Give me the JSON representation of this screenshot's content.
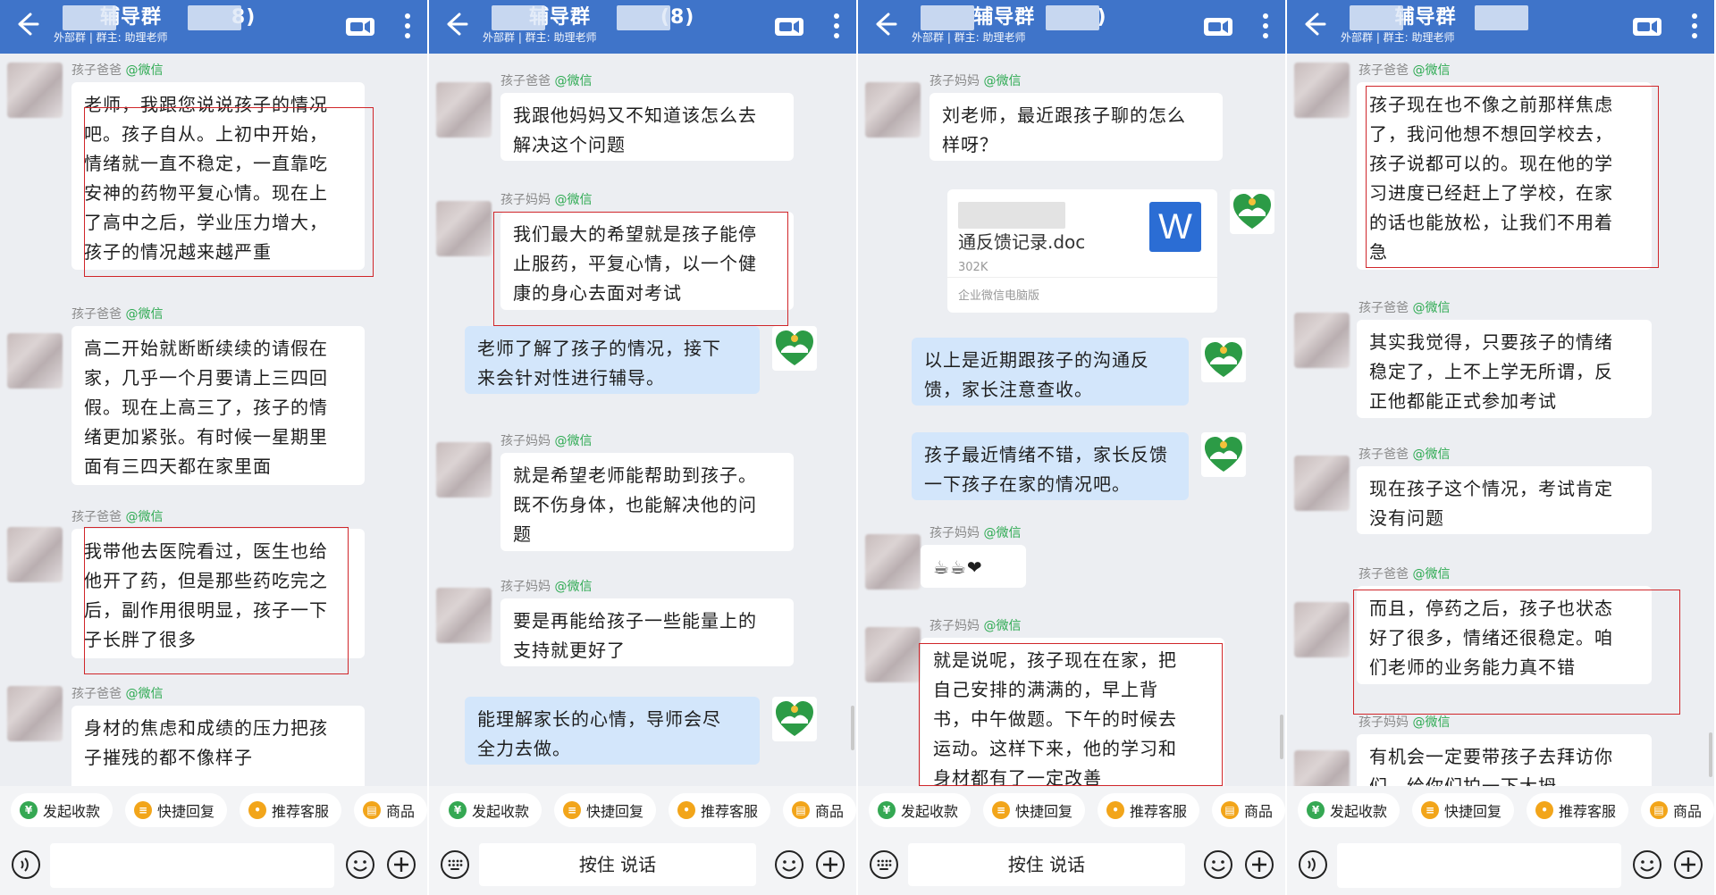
{
  "common": {
    "subtitle": "外部群 | 群主: 助理老师",
    "toolbar": [
      "发起收款",
      "快捷回复",
      "推荐客服",
      "商品"
    ],
    "hold_to_talk": "按住 说话"
  },
  "screens": [
    {
      "title": "      辅导群         8)",
      "messages": [
        {
          "sender": "孩子爸爸",
          "text": "老师，我跟您说说孩子的情况\n吧。孩子自从。上初中开始，\n情绪就一直不稳定，一直靠吃\n安神的药物平复心情。现在上\n了高中之后，学业压力增大，\n孩子的情况越来越严重"
        },
        {
          "sender": "孩子爸爸",
          "text": "高二开始就断断续续的请假在\n家，几乎一个月要请上三四回\n假。现在上高三了，孩子的情\n绪更加紧张。有时候一星期里\n面有三四天都在家里面"
        },
        {
          "sender": "孩子爸爸",
          "text": "我带他去医院看过，医生也给\n他开了药，但是那些药吃完之\n后，副作用很明显，孩子一下\n子长胖了很多"
        },
        {
          "sender": "孩子爸爸",
          "text": "身材的焦虑和成绩的压力把孩\n子摧残的都不像样子"
        }
      ]
    },
    {
      "title": "      辅导群         (8)",
      "messages": [
        {
          "sender": "孩子爸爸",
          "text": "我跟他妈妈又不知道该怎么去\n解决这个问题"
        },
        {
          "sender": "孩子妈妈",
          "text": "我们最大的希望就是孩子能停\n止服药，平复心情，以一个健\n康的身心去面对考试"
        },
        {
          "sender": "",
          "text": "老师了解了孩子的情况，接下\n来会针对性进行辅导。"
        },
        {
          "sender": "孩子妈妈",
          "text": "就是希望老师能帮助到孩子。\n既不伤身体，也能解决他的问\n题"
        },
        {
          "sender": "孩子妈妈",
          "text": "要是再能给孩子一些能量上的\n支持就更好了"
        },
        {
          "sender": "",
          "text": "能理解家长的心情，导师会尽\n全力去做。"
        }
      ]
    },
    {
      "title": "        辅导群        )",
      "messages": [
        {
          "sender": "孩子妈妈",
          "text": "刘老师，最近跟孩子聊的怎么\n样呀？"
        },
        {
          "sender": "",
          "text": "以上是近期跟孩子的沟通反\n馈，家长注意查收。"
        },
        {
          "sender": "",
          "text": "孩子最近情绪不错，家长反馈\n一下孩子在家的情况吧。"
        },
        {
          "sender": "孩子妈妈",
          "text": "☕☕❤"
        },
        {
          "sender": "孩子妈妈",
          "text": "就是说呢，孩子现在在家，把\n自己安排的满满的，早上背\n书，中午做题。下午的时候去\n运动。这样下来，他的学习和\n身材都有了一定改善"
        }
      ],
      "doc": {
        "name": "         阶段沟\n通反馈记录.doc",
        "size": "302K",
        "source": "企业微信电脑版",
        "icon_letter": "W"
      }
    },
    {
      "title": "       辅导群",
      "messages": [
        {
          "sender": "孩子爸爸",
          "text": "孩子现在也不像之前那样焦虑\n了，我问他想不想回学校去，\n孩子说都可以的。现在他的学\n习进度已经赶上了学校，在家\n的话也能放松，让我们不用着\n急"
        },
        {
          "sender": "孩子爸爸",
          "text": "其实我觉得，只要孩子的情绪\n稳定了，上不上学无所谓，反\n正他都能正式参加考试"
        },
        {
          "sender": "孩子爸爸",
          "text": "现在孩子这个情况，考试肯定\n没有问题"
        },
        {
          "sender": "孩子爸爸",
          "text": "而且，停药之后，孩子也状态\n好了很多，情绪还很稳定。咱\n们老师的业务能力真不错"
        },
        {
          "sender": "孩子妈妈",
          "text": "有机会一定要带孩子去拜访你\n们，给你们拍一下大拇"
        }
      ]
    }
  ],
  "wechat_tag": "@微信"
}
